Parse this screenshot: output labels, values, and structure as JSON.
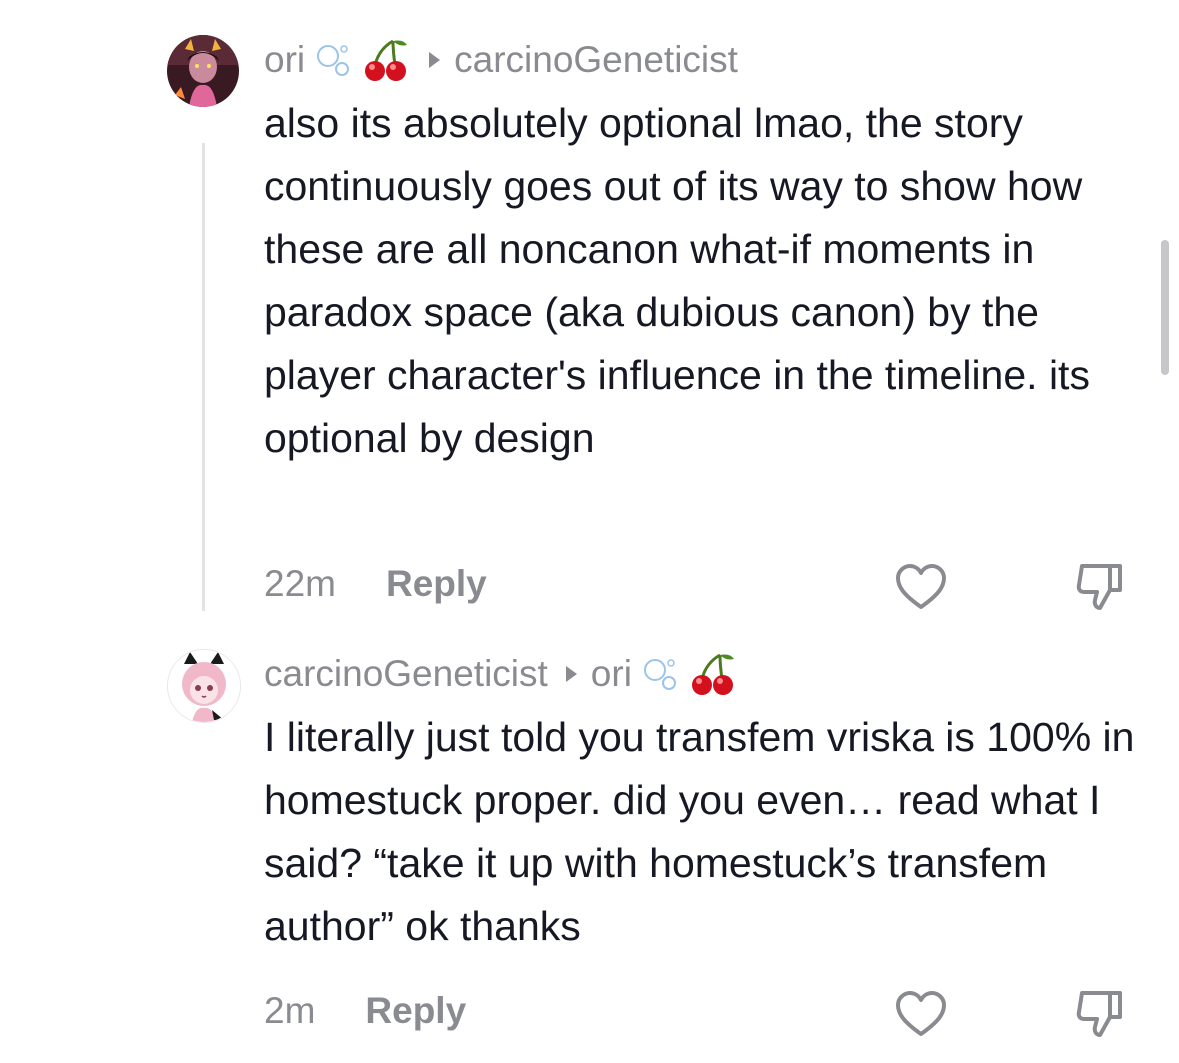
{
  "comments": [
    {
      "author": "ori",
      "reply_to": "carcinoGeneticist",
      "text": "also its absolutely optional lmao, the story continuously goes out of its way to show how these are all noncanon what-if moments in paradox space (aka dubious canon) by the player character's influence in the timeline. its optional by design",
      "time": "22m",
      "reply_label": "Reply",
      "avatar_icon": "avatar-troll-character",
      "author_emoji": [
        "bubbles-emoji",
        "cherry-emoji"
      ]
    },
    {
      "author": "carcinoGeneticist",
      "reply_to": "ori",
      "text": "I literally just told you transfem vriska is 100% in homestuck proper. did you even… read what I said? “take it up with homestuck’s transfem author” ok thanks",
      "time": "2m",
      "reply_label": "Reply",
      "avatar_icon": "avatar-pink-cat-girl",
      "reply_to_emoji": [
        "bubbles-emoji",
        "cherry-emoji"
      ]
    }
  ],
  "colors": {
    "text": "#161823",
    "secondary": "#8a8b91",
    "thread_line": "#e3e3e4",
    "cherry": "#d2101e"
  }
}
